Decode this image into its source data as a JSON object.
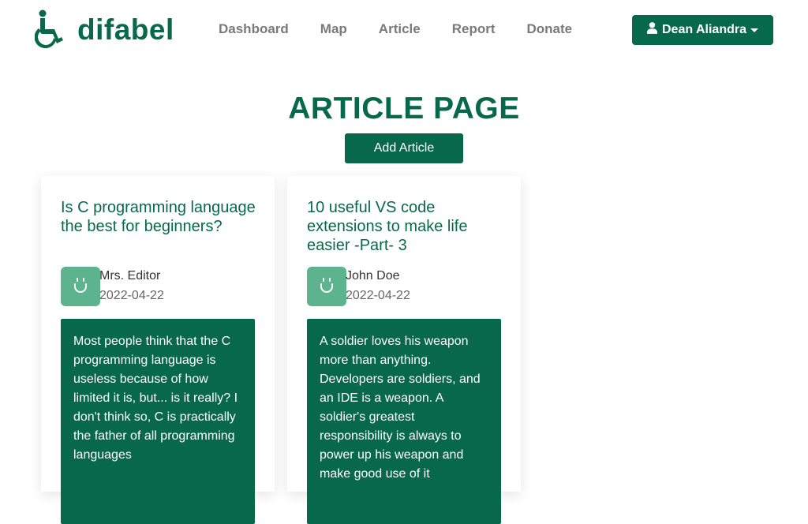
{
  "brand": {
    "name": "difabel",
    "color": "#08694a",
    "icon": "wheelchair-icon"
  },
  "nav": {
    "items": [
      {
        "label": "Dashboard"
      },
      {
        "label": "Map"
      },
      {
        "label": "Article"
      },
      {
        "label": "Report"
      },
      {
        "label": "Donate"
      }
    ]
  },
  "user": {
    "name": "Dean Aliandra",
    "icon": "user-icon"
  },
  "page": {
    "title": "ARTICLE PAGE",
    "add_button_label": "Add Article"
  },
  "articles": [
    {
      "title": "Is C programming language the best for beginners?",
      "author": "Mrs. Editor",
      "date": "2022-04-22",
      "excerpt": "Most people think that the C programming language is useless because of how limited it is, but... is it really? I don't think so, C is practically the father of all programming languages"
    },
    {
      "title": "10 useful VS code extensions to make life easier -Part- 3",
      "author": "John Doe",
      "date": "2022-04-22",
      "excerpt": "A soldier loves his weapon more than anything. Developers are soldiers, and an IDE is a weapon. A soldier's greatest responsibility is always to power up his weapon and make good use of it"
    }
  ],
  "colors": {
    "accent": "#08694a",
    "avatar_bg": "#5eb38f",
    "nav_text": "#7a7a7a"
  }
}
